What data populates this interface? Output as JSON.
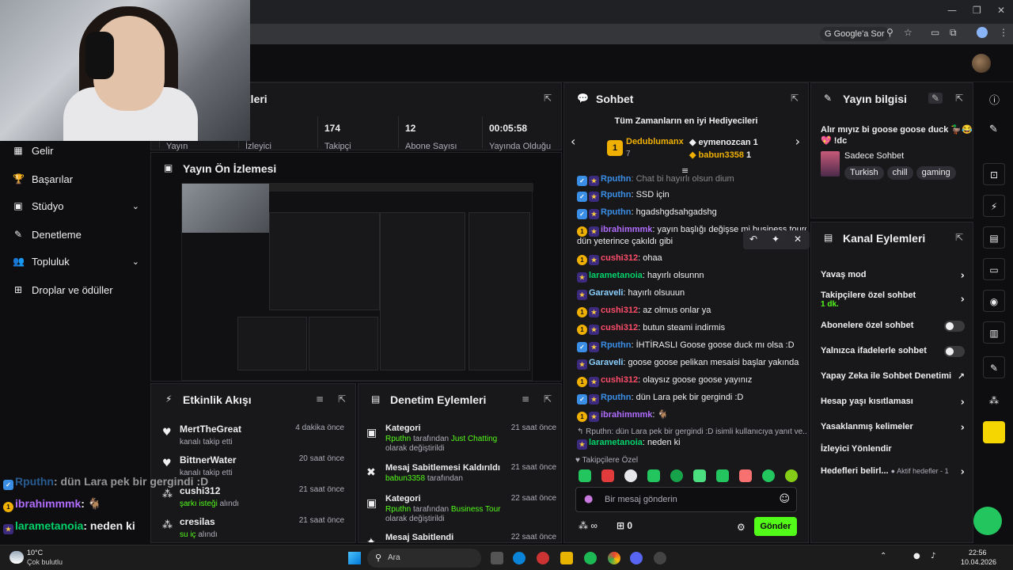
{
  "browser": {
    "google_button": "Google'a Sor"
  },
  "sidebar": {
    "items": [
      {
        "label": "Gelir",
        "icon": "table-icon"
      },
      {
        "label": "Başarılar",
        "icon": "trophy-icon"
      },
      {
        "label": "Stüdyo",
        "icon": "video-icon"
      },
      {
        "label": "Denetleme",
        "icon": "wrench-icon"
      },
      {
        "label": "Topluluk",
        "icon": "people-icon"
      },
      {
        "label": "Droplar ve ödüller",
        "icon": "gift-icon"
      }
    ]
  },
  "stats": {
    "title": "ikleri",
    "items": [
      {
        "value": "",
        "label": "Yayın"
      },
      {
        "value": "",
        "label": "İzleyici"
      },
      {
        "value": "174",
        "label": "Takipçi"
      },
      {
        "value": "12",
        "label": "Abone Sayısı"
      },
      {
        "value": "00:05:58",
        "label": "Yayında Olduğu"
      }
    ]
  },
  "preview": {
    "title": "Yayın Ön İzlemesi"
  },
  "overlay_chat": [
    {
      "user": "Rputhn",
      "text": ": dün Lara pek bir gergindi :D"
    },
    {
      "user": "ibrahimmmk",
      "text": ": 🐐"
    },
    {
      "user": "larametanoia",
      "text": ": neden ki"
    }
  ],
  "activity": {
    "title": "Etkinlik Akışı",
    "items": [
      {
        "name": "MertTheGreat",
        "desc": "kanalı takip etti",
        "time": "4 dakika önce",
        "icon": "heart-icon"
      },
      {
        "name": "BittnerWater",
        "desc": "kanalı takip etti",
        "time": "20 saat önce",
        "icon": "heart-icon"
      },
      {
        "name": "cushi312",
        "desc_prefix": "şarkı isteği",
        "desc": " alındı",
        "time": "21 saat önce",
        "icon": "points-icon"
      },
      {
        "name": "cresilas",
        "desc_prefix": "su iç",
        "desc": " alındı",
        "time": "21 saat önce",
        "icon": "points-icon"
      }
    ]
  },
  "moderation": {
    "title": "Denetim Eylemleri",
    "items": [
      {
        "name": "Kategori",
        "user": "Rputhn",
        "mid": " tarafından ",
        "target": "Just Chatting",
        "end": " olarak değiştirildi",
        "time": "21 saat önce"
      },
      {
        "name": "Mesaj Sabitlemesi Kaldırıldı",
        "user": "babun3358",
        "mid": " tarafından",
        "target": "",
        "end": "",
        "time": "21 saat önce"
      },
      {
        "name": "Kategori",
        "user": "Rputhn",
        "mid": " tarafından ",
        "target": "Business Tour",
        "end": " olarak değiştirildi",
        "time": "22 saat önce"
      },
      {
        "name": "Mesaj Sabitlendi",
        "user": "",
        "mid": "",
        "target": "",
        "end": "",
        "time": "22 saat önce"
      }
    ]
  },
  "chat": {
    "title": "Sohbet",
    "gifters_title": "Tüm Zamanların en iyi Hediyecileri",
    "top1": {
      "name": "Dedublumanx",
      "count": "7"
    },
    "top2": {
      "name": "eymenozcan",
      "count": "1"
    },
    "top3": {
      "name": "babun3358",
      "count": "1"
    },
    "messages": [
      {
        "user": "Rputhn",
        "color": "u-blue",
        "badge": "blue",
        "text": ": Chat bi hayırlı olsun dium"
      },
      {
        "user": "Rputhn",
        "color": "u-blue",
        "badge": "blue",
        "text": ": SSD için"
      },
      {
        "user": "Rputhn",
        "color": "u-blue",
        "badge": "blue",
        "text": ": hgadshgdsahgadshg"
      },
      {
        "user": "ibrahimmmk",
        "color": "u-purple",
        "badge": "gold",
        "text": ": yayın başlığı değişse mi business tourda"
      },
      {
        "user": "",
        "color": "",
        "badge": "",
        "text": "dün yeterince çakıldı gibi"
      },
      {
        "user": "cushi312",
        "color": "u-red",
        "badge": "gold",
        "text": ": ohaa"
      },
      {
        "user": "larametanoia",
        "color": "u-green",
        "badge": "star",
        "text": ": hayırlı olsunnn"
      },
      {
        "user": "Garaveli",
        "color": "u-teal",
        "badge": "star",
        "text": ": hayırlı olsuuun"
      },
      {
        "user": "cushi312",
        "color": "u-red",
        "badge": "gold",
        "text": ": az olmus onlar ya"
      },
      {
        "user": "cushi312",
        "color": "u-red",
        "badge": "gold",
        "text": ": butun steami indirmis"
      },
      {
        "user": "Rputhn",
        "color": "u-blue",
        "badge": "blue",
        "text": ": İHTİRASLI Goose goose duck mı olsa :D"
      },
      {
        "user": "Garaveli",
        "color": "u-teal",
        "badge": "star",
        "text": ": goose goose pelikan mesaisi başlar yakında"
      },
      {
        "user": "cushi312",
        "color": "u-red",
        "badge": "gold",
        "text": ": olaysız goose goose yayınız"
      },
      {
        "user": "Rputhn",
        "color": "u-blue",
        "badge": "blue",
        "text": ": dün Lara pek bir gergindi :D"
      },
      {
        "user": "ibrahimmmk",
        "color": "u-purple",
        "badge": "gold",
        "text": ": 🐐"
      }
    ],
    "reply_to": "↰ Rputhn: dün Lara pek bir gergindi :D isimli kullanıcıya yanıt ve...",
    "last": {
      "user": "larametanoia",
      "text": ": neden ki"
    },
    "followers_only": "Takipçilere Özel",
    "input_placeholder": "Bir mesaj gönderin",
    "points": "∞",
    "gift_count": "0",
    "send": "Gönder"
  },
  "stream_info": {
    "title": "Yayın bilgisi",
    "stream_title": "Alır mıyız bi goose goose duck 🦆😂",
    "stream_title2": "💖 !dc",
    "category": "Sadece Sohbet",
    "tags": [
      "Turkish",
      "chill",
      "gaming"
    ]
  },
  "channel_actions": {
    "title": "Kanal Eylemleri",
    "slow": "Yavaş mod",
    "followers": "Takipçilere özel sohbet",
    "followers_sub": "1 dk.",
    "subs": "Abonelere özel sohbet",
    "emote": "Yalnızca ifadelerle sohbet",
    "ai": "Yapay Zeka ile Sohbet Denetimi",
    "age": "Hesap yaşı kısıtlaması",
    "banned": "Yasaklanmış kelimeler",
    "raid": "İzleyici Yönlendir",
    "goals": "Hedefleri belirl...",
    "goals_status": "● Aktif hedefler - 1"
  },
  "taskbar": {
    "weather_temp": "10°C",
    "weather_desc": "Çok bulutlu",
    "search": "Ara",
    "time": "22:56",
    "date": "10.04.2026"
  }
}
